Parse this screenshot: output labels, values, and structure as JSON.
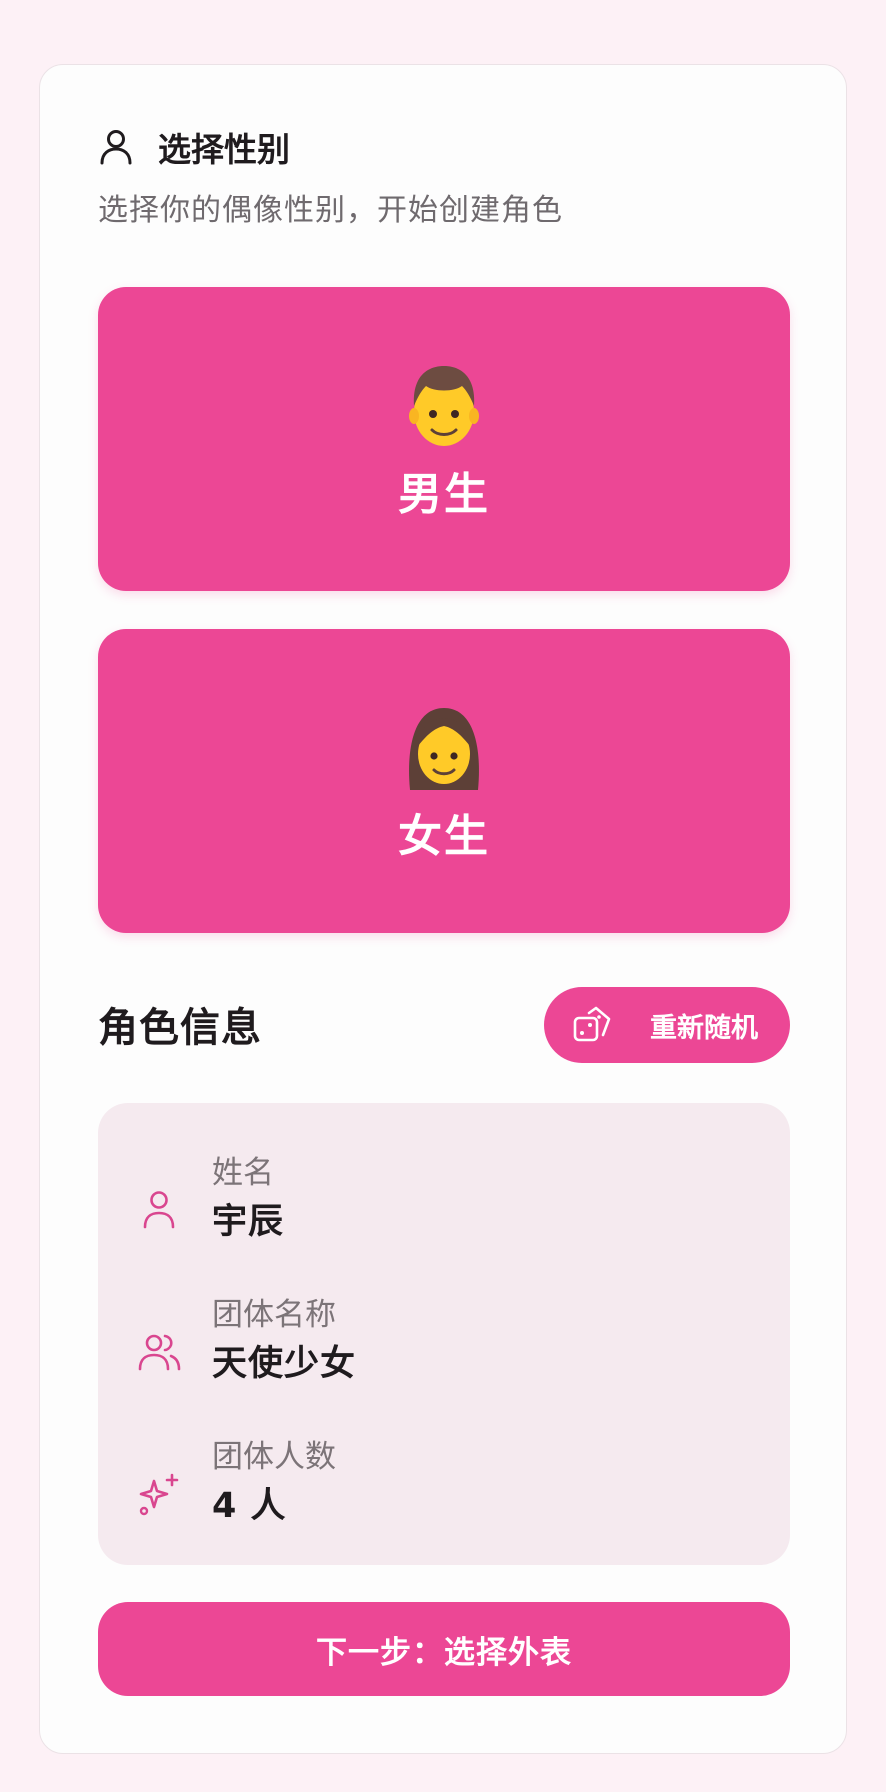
{
  "header": {
    "icon": "person-icon",
    "title": "选择性别",
    "subtitle": "选择你的偶像性别，开始创建角色"
  },
  "gender_options": [
    {
      "emoji_icon": "man-emoji-icon",
      "label": "男生"
    },
    {
      "emoji_icon": "woman-emoji-icon",
      "label": "女生"
    }
  ],
  "character_info": {
    "title": "角色信息",
    "reroll_button": {
      "icon": "dice-icon",
      "label": "重新随机"
    },
    "fields": [
      {
        "icon": "person-icon",
        "label": "姓名",
        "value": "宇辰"
      },
      {
        "icon": "group-icon",
        "label": "团体名称",
        "value": "天使少女"
      },
      {
        "icon": "sparkle-icon",
        "label": "团体人数",
        "value": "4 人"
      }
    ]
  },
  "next_button": {
    "label": "下一步：选择外表"
  },
  "colors": {
    "accent": "#ec4795",
    "page_bg": "#fdf1f6",
    "card_bg": "#fdfdfd",
    "info_bg": "#f5eaef",
    "text_primary": "#1f1b1e",
    "text_secondary": "#6f6a6e"
  }
}
